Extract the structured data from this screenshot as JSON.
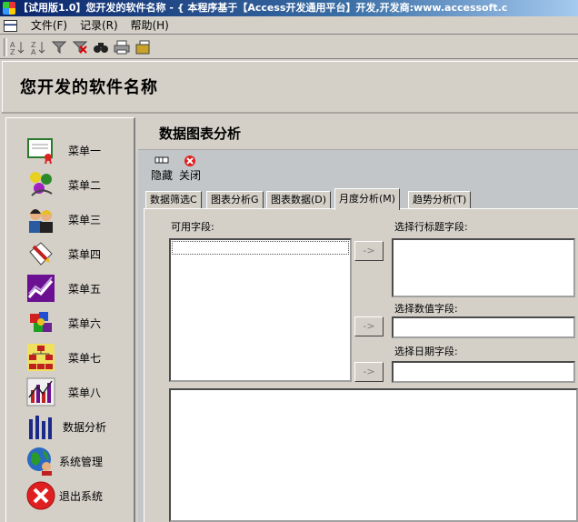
{
  "window": {
    "title": "【试用版1.0】您开发的软件名称 - { 本程序基于【Access开发通用平台】开发,开发商:www.accessoft.c"
  },
  "menu": {
    "items": [
      {
        "label": "文件(F)"
      },
      {
        "label": "记录(R)"
      },
      {
        "label": "帮助(H)"
      }
    ]
  },
  "toolbar": {
    "icons": [
      "sort-ascending-icon",
      "sort-descending-icon",
      "filter-icon",
      "remove-filter-icon",
      "find-icon",
      "print-icon",
      "open-icon"
    ]
  },
  "header": {
    "title": "您开发的软件名称"
  },
  "sidebar": {
    "items": [
      {
        "label": "菜单一"
      },
      {
        "label": "菜单二"
      },
      {
        "label": "菜单三"
      },
      {
        "label": "菜单四"
      },
      {
        "label": "菜单五"
      },
      {
        "label": "菜单六"
      },
      {
        "label": "菜单七"
      },
      {
        "label": "菜单八"
      },
      {
        "label": "数据分析"
      },
      {
        "label": "系统管理"
      },
      {
        "label": "退出系统"
      }
    ]
  },
  "main": {
    "title": "数据图表分析",
    "buttons": {
      "hide": "隐藏",
      "close": "关闭"
    },
    "tabs": [
      {
        "label": "数据筛选C"
      },
      {
        "label": "图表分析G"
      },
      {
        "label": "图表数据(D)"
      },
      {
        "label": "月度分析(M)"
      },
      {
        "label": "趋势分析(T)"
      }
    ],
    "active_tab": "月度分析(M)",
    "fields": {
      "available_label": "可用字段:",
      "row_label": "选择行标题字段:",
      "value_label": "选择数值字段:",
      "date_label": "选择日期字段:",
      "arrow": "->"
    }
  },
  "colors": {
    "title_bar": "#0a246a",
    "face": "#d4d0c8",
    "main_bg": "#c2c6c8",
    "close_red": "#e02020"
  }
}
